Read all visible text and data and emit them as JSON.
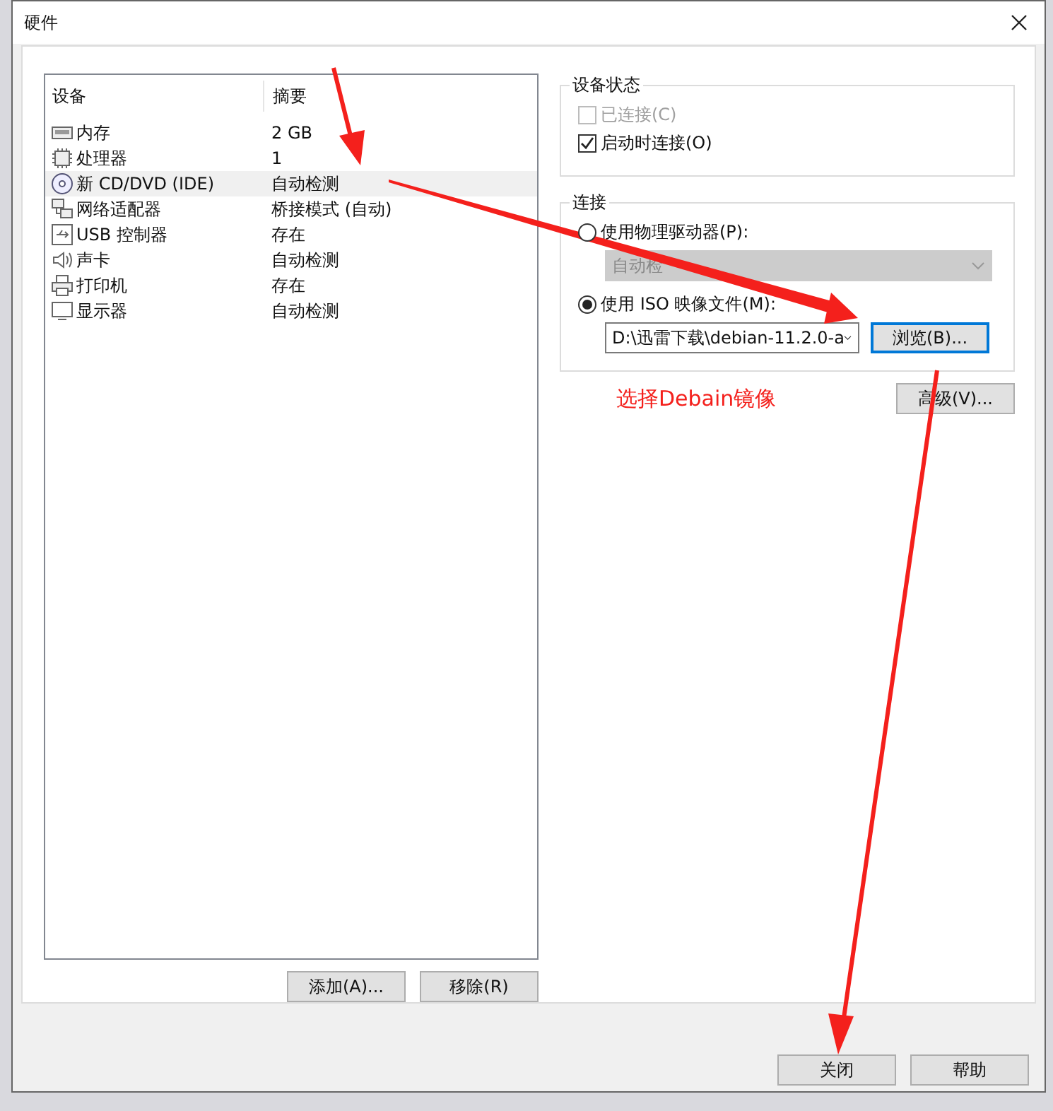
{
  "window": {
    "title": "硬件"
  },
  "devices": {
    "columns": [
      "设备",
      "摘要"
    ],
    "rows": [
      {
        "kind": "memory",
        "name": "内存",
        "summary": "2 GB",
        "selected": false
      },
      {
        "kind": "cpu",
        "name": "处理器",
        "summary": "1",
        "selected": false
      },
      {
        "kind": "disc",
        "name": "新 CD/DVD (IDE)",
        "summary": "自动检测",
        "selected": true
      },
      {
        "kind": "network",
        "name": "网络适配器",
        "summary": "桥接模式 (自动)",
        "selected": false
      },
      {
        "kind": "usb",
        "name": "USB 控制器",
        "summary": "存在",
        "selected": false
      },
      {
        "kind": "sound",
        "name": "声卡",
        "summary": "自动检测",
        "selected": false
      },
      {
        "kind": "printer",
        "name": "打印机",
        "summary": "存在",
        "selected": false
      },
      {
        "kind": "display",
        "name": "显示器",
        "summary": "自动检测",
        "selected": false
      }
    ],
    "buttons": [
      "添加(A)...",
      "移除(R)"
    ]
  },
  "device_status": {
    "title": "设备状态",
    "checkboxes": [
      {
        "label": "已连接(C)",
        "checked": false,
        "disabled": true
      },
      {
        "label": "启动时连接(O)",
        "checked": true,
        "disabled": false
      }
    ]
  },
  "connection": {
    "title": "连接",
    "physical": {
      "label": "使用物理驱动器(P):",
      "selected": false,
      "value": "自动检",
      "disabled": true
    },
    "iso": {
      "label": "使用 ISO 映像文件(M):",
      "selected": true,
      "value": "D:\\迅雷下载\\debian-11.2.0-a",
      "browse": "浏览(B)..."
    }
  },
  "advanced_button": "高级(V)...",
  "annotation": {
    "caption": "选择Debain镜像"
  },
  "footer_buttons": [
    "关闭",
    "帮助"
  ]
}
